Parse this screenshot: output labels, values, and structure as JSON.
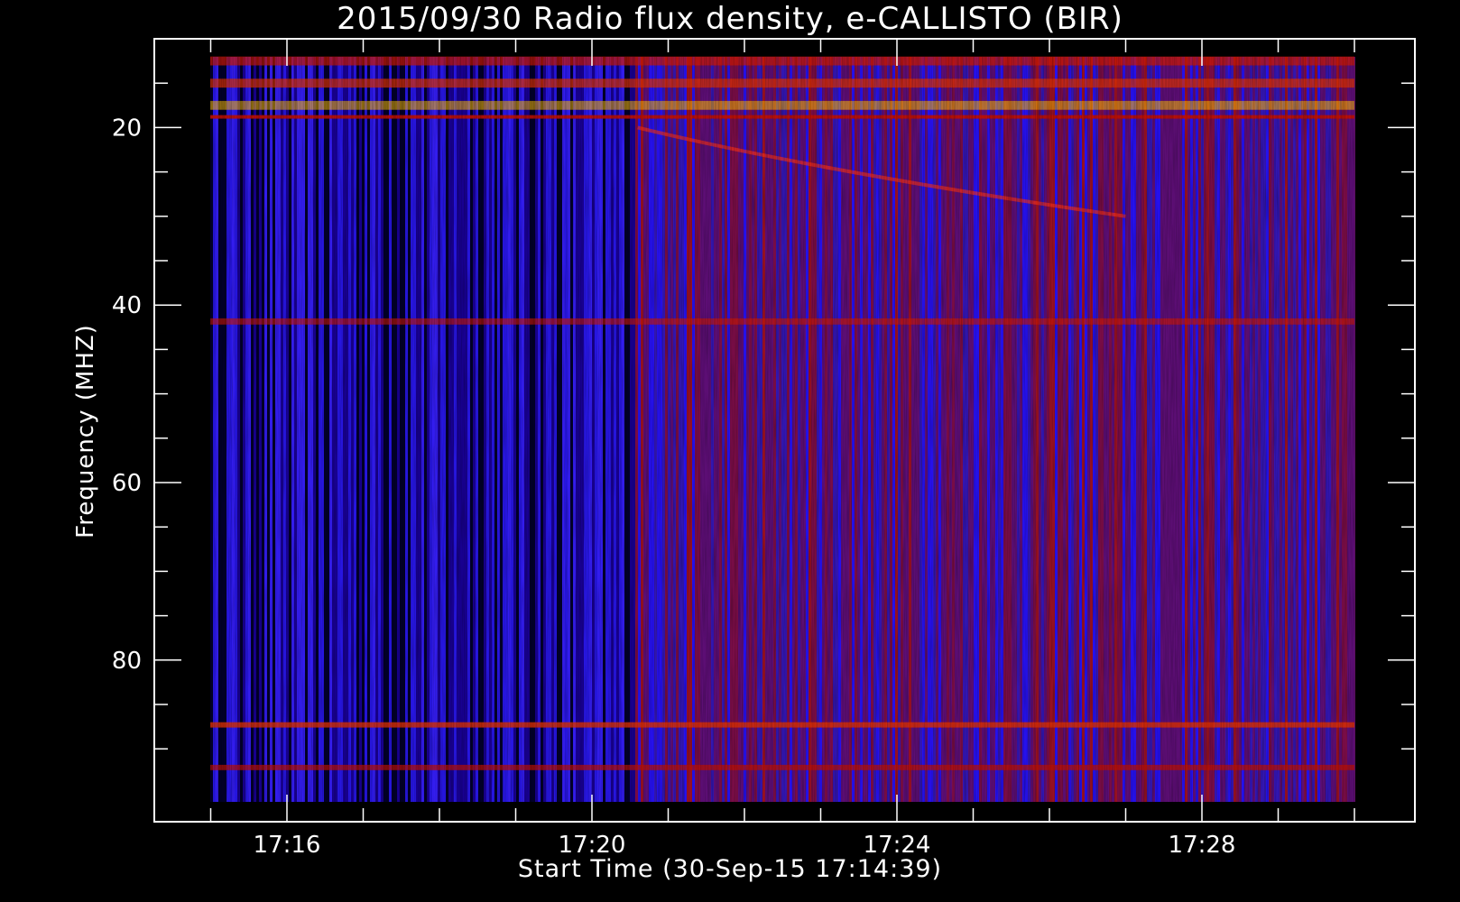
{
  "chart_data": {
    "type": "heatmap",
    "title": "2015/09/30  Radio flux density, e-CALLISTO (BIR)",
    "xlabel": "Start Time (30-Sep-15 17:14:39)",
    "ylabel": "Frequency (MHZ)",
    "x_ticks": [
      "17:16",
      "17:20",
      "17:24",
      "17:28"
    ],
    "y_ticks": [
      20,
      40,
      60,
      80
    ],
    "x_range": [
      "17:14:39",
      "17:30:00"
    ],
    "y_range": [
      10,
      95
    ],
    "y_inverted": true,
    "colormap": {
      "low": "#000000",
      "mid": "#2a12ff",
      "high": "#c41200",
      "peak": "#ffff40"
    },
    "bands": [
      {
        "name": "bright top band",
        "freq": [
          10,
          18
        ],
        "intensity": "high"
      },
      {
        "name": "type III-like streak",
        "freq": [
          20,
          30
        ],
        "time": [
          "17:21",
          "17:27"
        ],
        "intensity": "high"
      },
      {
        "name": "lower interference band",
        "freq": [
          86,
          93
        ],
        "intensity": "medium"
      }
    ]
  }
}
